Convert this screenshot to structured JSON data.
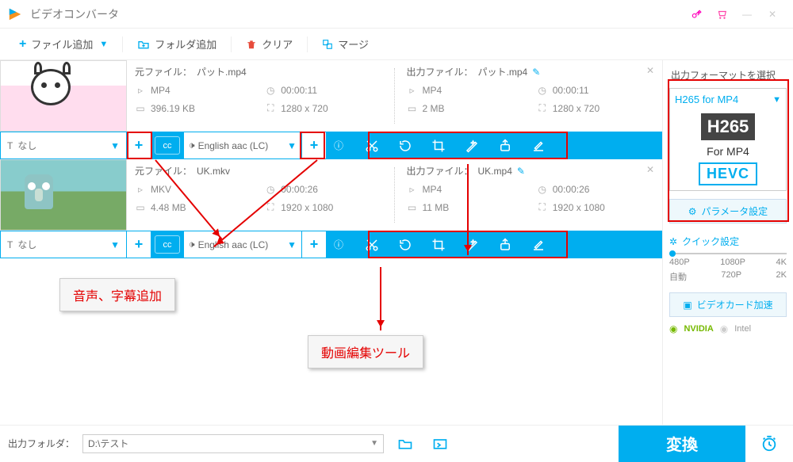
{
  "app": {
    "title": "ビデオコンバータ"
  },
  "toolbar": {
    "add_file": "ファイル追加",
    "add_folder": "フォルダ追加",
    "clear": "クリア",
    "merge": "マージ"
  },
  "items": [
    {
      "src": {
        "label": "元ファイル：",
        "name": "パット.mp4",
        "format": "MP4",
        "duration": "00:00:11",
        "size": "396.19 KB",
        "res": "1280 x 720"
      },
      "out": {
        "label": "出力ファイル：",
        "name": "パット.mp4",
        "format": "MP4",
        "duration": "00:00:11",
        "size": "2 MB",
        "res": "1280 x 720"
      },
      "subtitle": "なし",
      "audio": "English aac (LC)"
    },
    {
      "src": {
        "label": "元ファイル：",
        "name": "UK.mkv",
        "format": "MKV",
        "duration": "00:00:26",
        "size": "4.48 MB",
        "res": "1920 x 1080"
      },
      "out": {
        "label": "出力ファイル：",
        "name": "UK.mp4",
        "format": "MP4",
        "duration": "00:00:26",
        "size": "11 MB",
        "res": "1920 x 1080"
      },
      "subtitle": "なし",
      "audio": "English aac (LC)"
    }
  ],
  "annotations": {
    "add_audio_sub": "音声、字幕追加",
    "edit_tools": "動画編集ツール"
  },
  "side": {
    "title": "出力フォーマットを選択",
    "format_name": "H265 for MP4",
    "h265": "H265",
    "for": "For MP4",
    "hevc": "HEVC",
    "params": "パラメータ設定",
    "quick": "クイック設定",
    "res_top": [
      "480P",
      "1080P",
      "4K"
    ],
    "res_bot": [
      "自動",
      "720P",
      "2K"
    ],
    "hw": "ビデオカード加速",
    "nvidia": "NVIDIA",
    "intel": "Intel"
  },
  "bottom": {
    "label": "出力フォルダ：",
    "path": "D:\\テスト",
    "convert": "変換"
  }
}
